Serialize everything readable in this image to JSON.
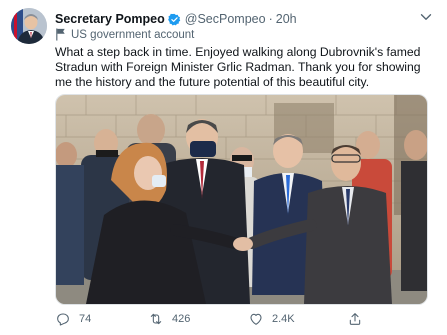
{
  "author": {
    "name": "Secretary Pompeo",
    "handle": "@SecPompeo",
    "separator": "·",
    "time": "20h",
    "label": "US government account"
  },
  "tweet": {
    "text": "What a step back in time. Enjoyed walking along Dubrovnik's famed Stradun with Foreign Minister Grlic Radman. Thank you for showing me the history and the future potential of this beautiful city."
  },
  "actions": {
    "replies": "74",
    "retweets": "426",
    "likes": "2.4K"
  },
  "colors": {
    "verified": "#1d9bf0",
    "muted": "#536471",
    "text": "#0f1419"
  }
}
